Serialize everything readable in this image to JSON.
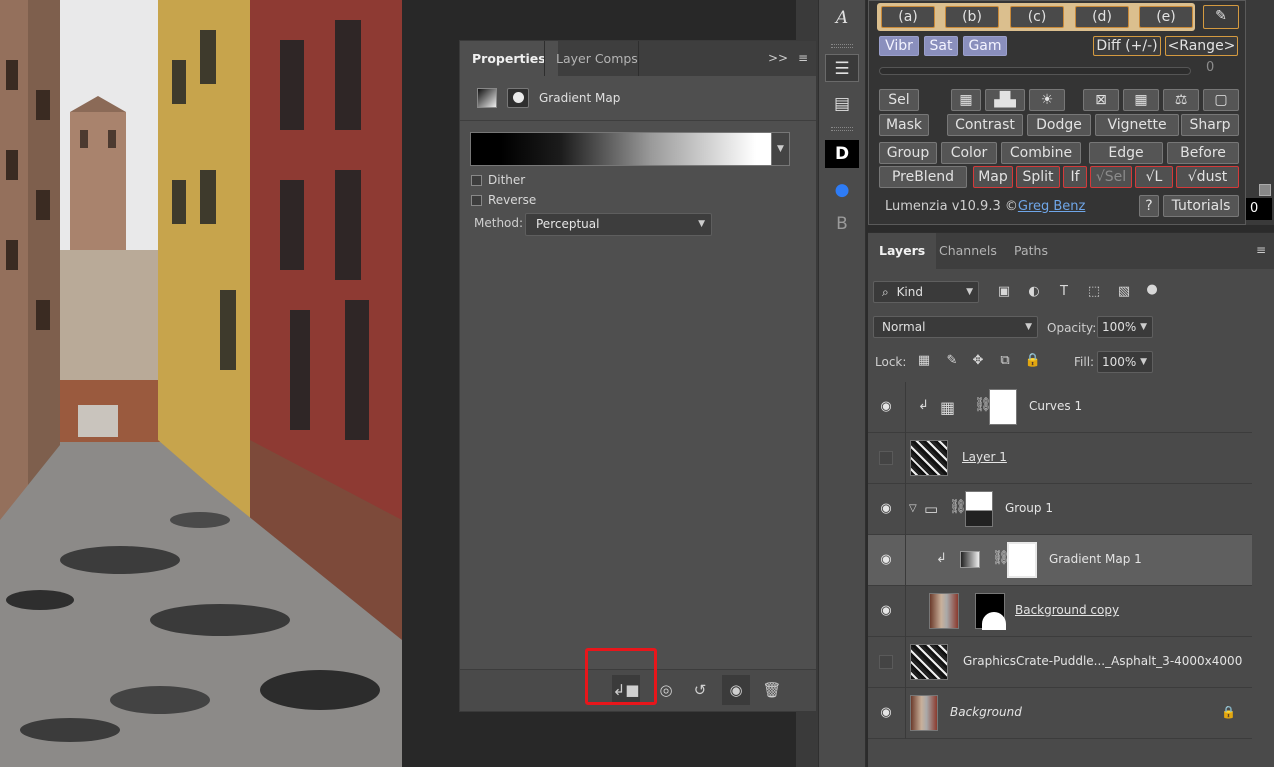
{
  "properties_panel": {
    "tabs": [
      "Properties",
      "Layer Comps"
    ],
    "adjustment_title": "Gradient Map",
    "dither_label": "Dither",
    "reverse_label": "Reverse",
    "method_label": "Method:",
    "method_value": "Perceptual",
    "collapse_icon": "double-chevron-right",
    "menu_icon": "panel-menu"
  },
  "toolbar_icons": [
    "character-icon",
    "adjustments-icon",
    "properties-icon",
    "plugin-d-icon",
    "eye-plugin-icon",
    "plugin-b-icon"
  ],
  "lumenzia": {
    "letters": [
      "(a)",
      "(b)",
      "(c)",
      "(d)",
      "(e)"
    ],
    "vibr": "Vibr",
    "sat": "Sat",
    "gam": "Gam",
    "diff": "Diff (+/-)",
    "range": "<Range>",
    "slider_value": "0",
    "sel": "Sel",
    "mask": "Mask",
    "contrast": "Contrast",
    "dodge": "Dodge",
    "vignette": "Vignette",
    "sharp": "Sharp",
    "group": "Group",
    "color": "Color",
    "combine": "Combine",
    "edge": "Edge",
    "before": "Before",
    "preblend": "PreBlend",
    "map": "Map",
    "split": "Split",
    "if": "If",
    "check_sel": "√Sel",
    "check_l": "√L",
    "check_dust": "√dust",
    "version_prefix": "Lumenzia v10.9.3 ©",
    "author": "Greg Benz",
    "help": "?",
    "tutorials": "Tutorials",
    "value_box": "0"
  },
  "layers_panel": {
    "tabs": [
      "Layers",
      "Channels",
      "Paths"
    ],
    "filter_kind": "Kind",
    "blend_mode": "Normal",
    "opacity_label": "Opacity:",
    "opacity_value": "100%",
    "lock_label": "Lock:",
    "fill_label": "Fill:",
    "fill_value": "100%",
    "layers": [
      {
        "name": "Curves 1",
        "visible": true
      },
      {
        "name": "Layer 1",
        "visible": false
      },
      {
        "name": "Group 1",
        "visible": true
      },
      {
        "name": "Gradient Map 1",
        "visible": true,
        "selected": true
      },
      {
        "name": "Background copy",
        "visible": true
      },
      {
        "name": "GraphicsCrate-Puddle..._Asphalt_3-4000x4000",
        "visible": false
      },
      {
        "name": "Background",
        "visible": true,
        "locked": true
      }
    ]
  }
}
